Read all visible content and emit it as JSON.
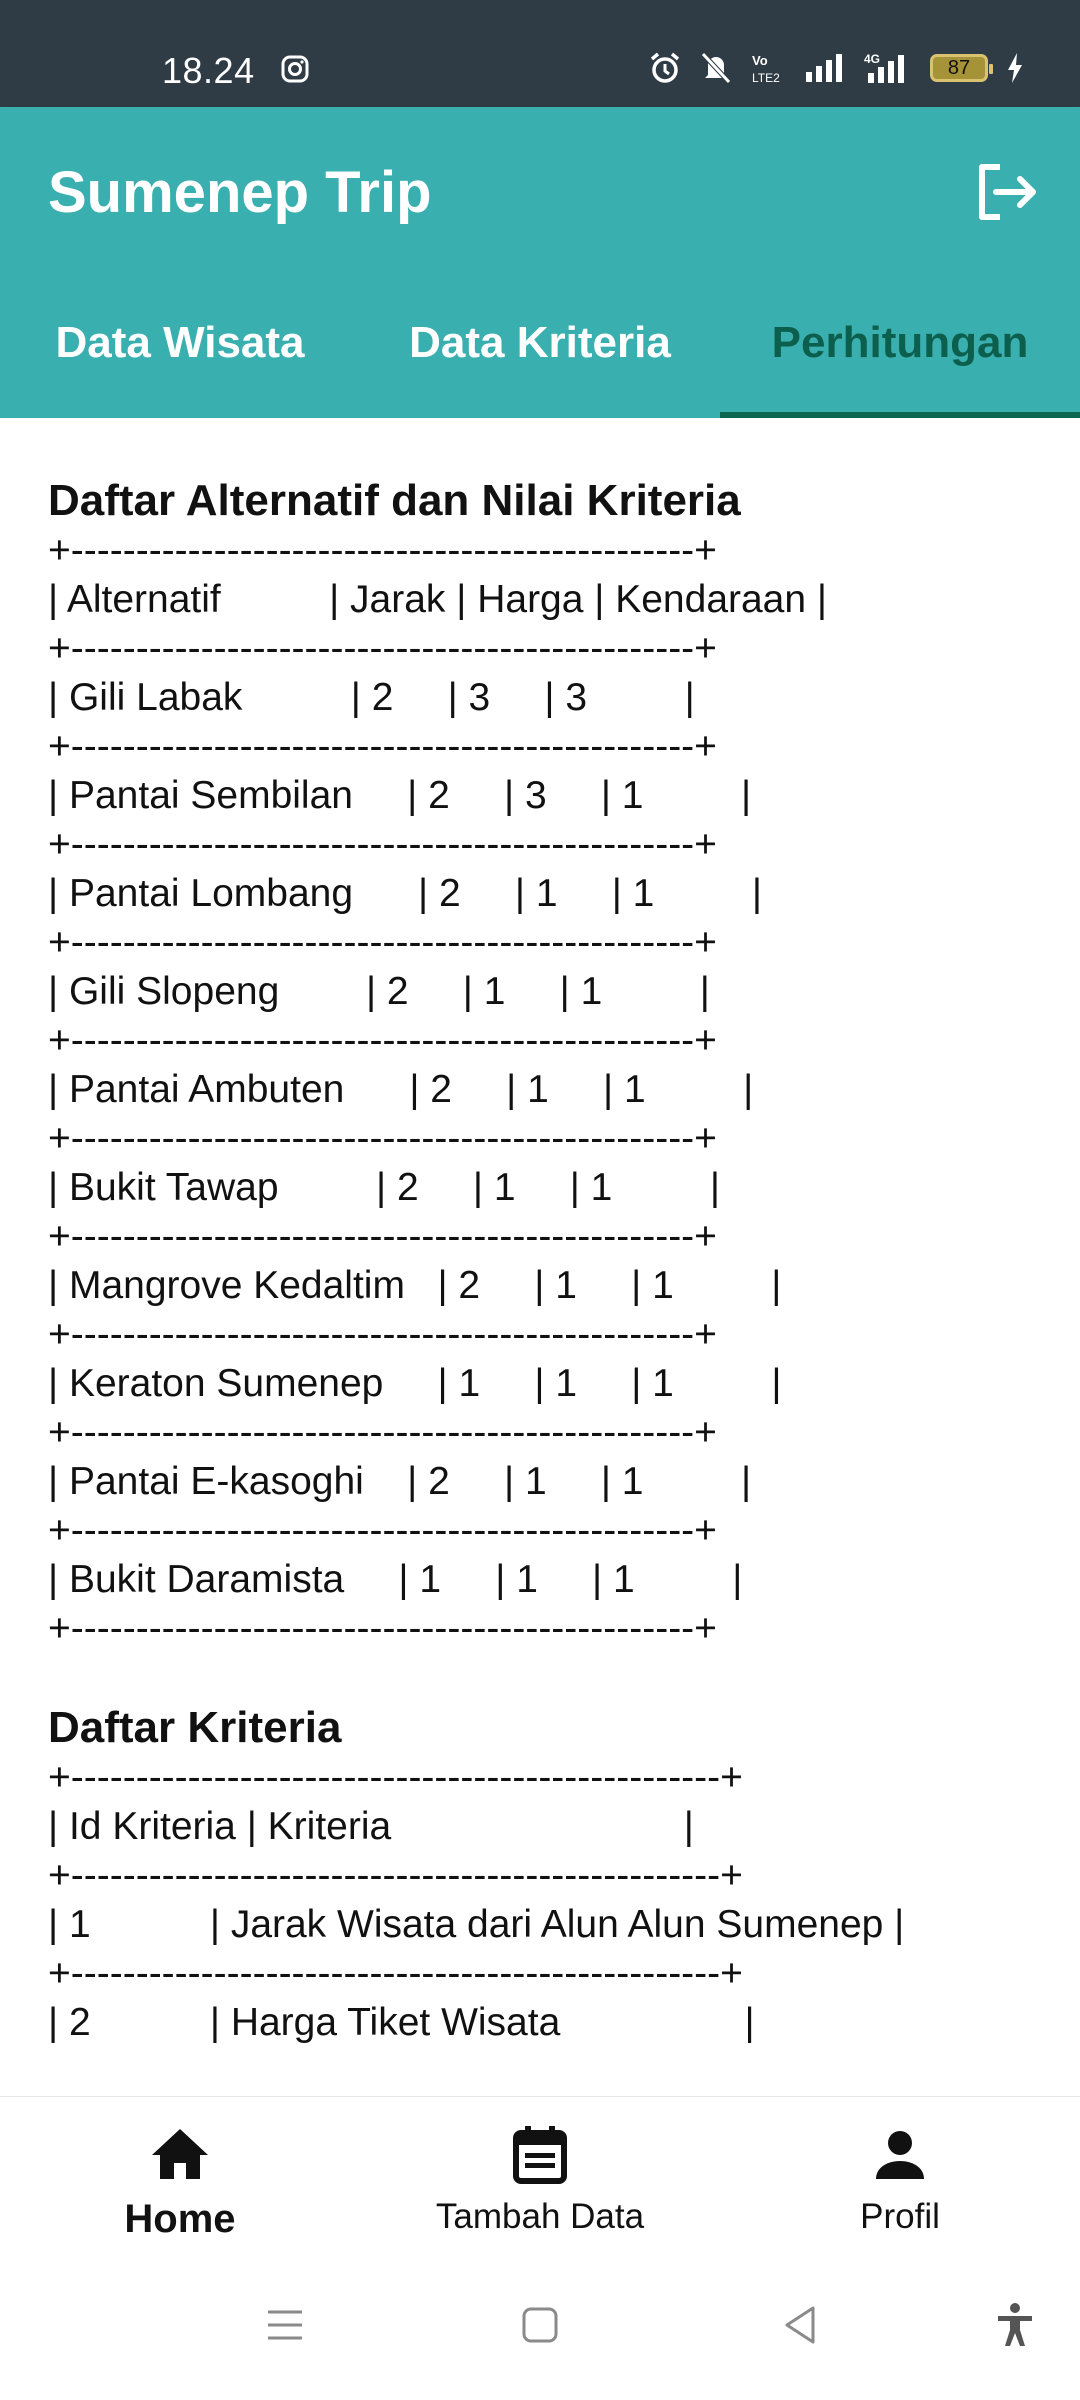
{
  "status_bar": {
    "time": "18.24",
    "battery": "87",
    "icons": [
      "instagram-icon",
      "alarm-icon",
      "mute-icon",
      "volte-icon",
      "signal-icon",
      "4g-signal-icon",
      "battery-icon",
      "charging-icon"
    ]
  },
  "app_bar": {
    "title": "Sumenep Trip",
    "logout_icon": "logout-icon"
  },
  "tabs": [
    {
      "label": "Data Wisata",
      "active": false
    },
    {
      "label": "Data Kriteria",
      "active": false
    },
    {
      "label": "Perhitungan",
      "active": true
    }
  ],
  "colors": {
    "primary": "#3aafb0",
    "active_tab_text": "#0d5f4d",
    "status_bar": "#2f3b45"
  },
  "alternatives_section": {
    "title": "Daftar Alternatif dan Nilai Kriteria",
    "lines": [
      "+------------------------------------------------+",
      "| Alternatif          | Jarak | Harga | Kendaraan |",
      "+------------------------------------------------+",
      "| Gili Labak          | 2     | 3     | 3         |",
      "+------------------------------------------------+",
      "| Pantai Sembilan     | 2     | 3     | 1         |",
      "+------------------------------------------------+",
      "| Pantai Lombang      | 2     | 1     | 1         |",
      "+------------------------------------------------+",
      "| Gili Slopeng        | 2     | 1     | 1         |",
      "+------------------------------------------------+",
      "| Pantai Ambuten      | 2     | 1     | 1         |",
      "+------------------------------------------------+",
      "| Bukit Tawap         | 2     | 1     | 1         |",
      "+------------------------------------------------+",
      "| Mangrove Kedaltim   | 2     | 1     | 1         |",
      "+------------------------------------------------+",
      "| Keraton Sumenep     | 1     | 1     | 1         |",
      "+------------------------------------------------+",
      "| Pantai E-kasoghi    | 2     | 1     | 1         |",
      "+------------------------------------------------+",
      "| Bukit Daramista     | 1     | 1     | 1         |",
      "+------------------------------------------------+"
    ]
  },
  "criteria_section": {
    "title": "Daftar Kriteria",
    "lines": [
      "+--------------------------------------------------+",
      "| Id Kriteria | Kriteria                           |",
      "+--------------------------------------------------+",
      "| 1           | Jarak Wisata dari Alun Alun Sumenep |",
      "+--------------------------------------------------+",
      "| 2           | Harga Tiket Wisata                 |"
    ]
  },
  "bottom_nav": [
    {
      "label": "Home",
      "icon": "home-icon",
      "active": true
    },
    {
      "label": "Tambah Data",
      "icon": "calendar-icon",
      "active": false
    },
    {
      "label": "Profil",
      "icon": "person-icon",
      "active": false
    }
  ],
  "system_nav": [
    "menu-icon",
    "home-square-icon",
    "back-icon",
    "accessibility-icon"
  ]
}
